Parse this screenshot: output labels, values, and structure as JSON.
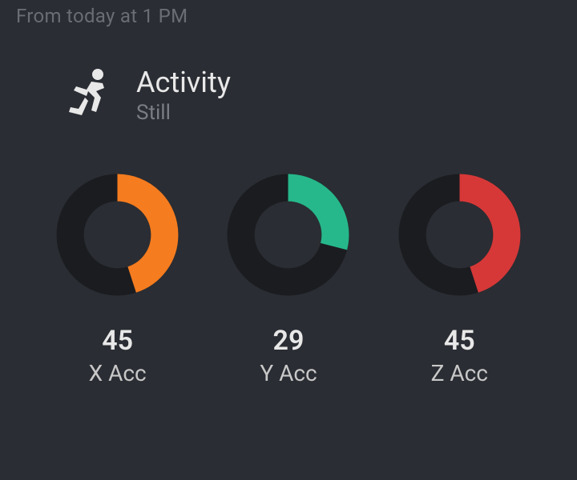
{
  "header": {
    "timestamp": "From today at 1 PM"
  },
  "activity": {
    "title": "Activity",
    "status": "Still"
  },
  "gauges": [
    {
      "value": 45,
      "label": "X Acc",
      "color": "#f57c1f",
      "percent": 45
    },
    {
      "value": 29,
      "label": "Y Acc",
      "color": "#26b88a",
      "percent": 29
    },
    {
      "value": 45,
      "label": "Z Acc",
      "color": "#d63838",
      "percent": 45
    }
  ],
  "chart_data": {
    "type": "bar",
    "title": "Activity",
    "categories": [
      "X Acc",
      "Y Acc",
      "Z Acc"
    ],
    "values": [
      45,
      29,
      45
    ],
    "ylim": [
      0,
      100
    ],
    "xlabel": "",
    "ylabel": ""
  }
}
